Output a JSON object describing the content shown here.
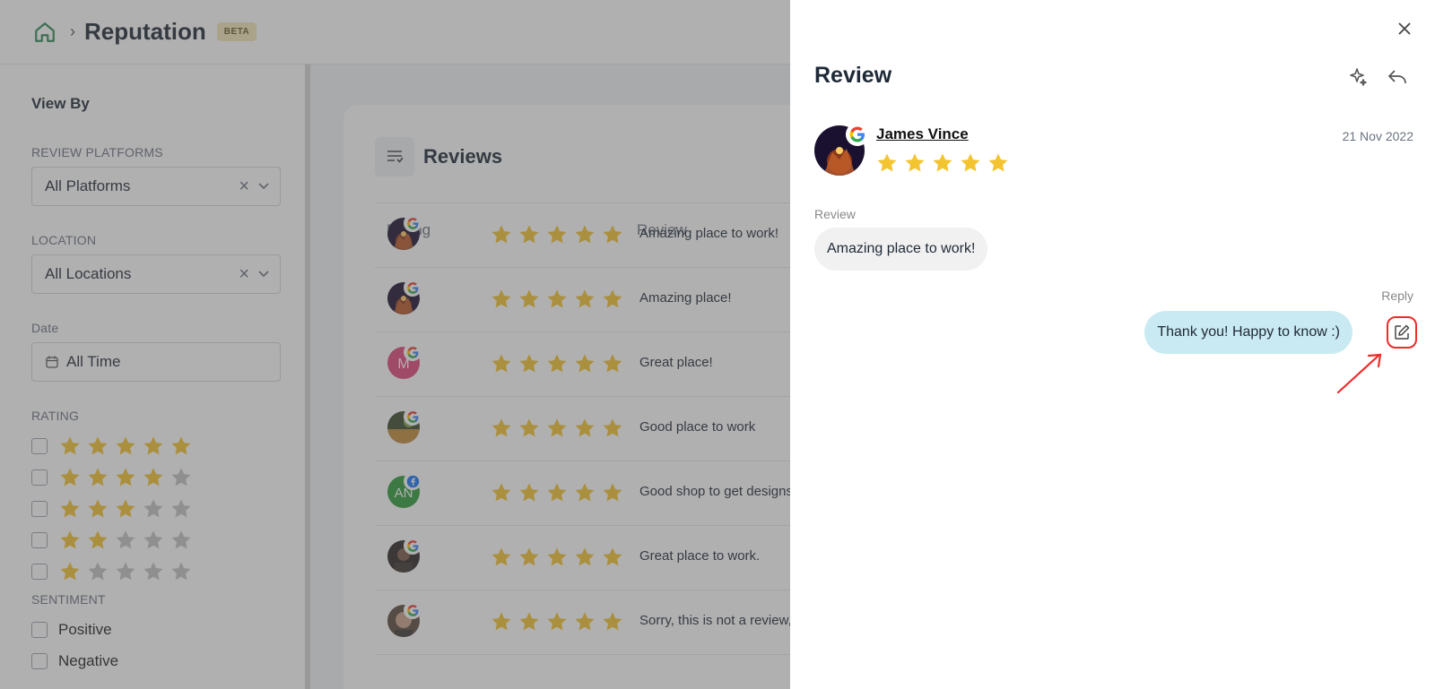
{
  "header": {
    "title": "Reputation",
    "badge": "BETA"
  },
  "filters": {
    "view_by": "View By",
    "platforms_label": "REVIEW PLATFORMS",
    "platforms_value": "All Platforms",
    "location_label": "LOCATION",
    "location_value": "All Locations",
    "date_label": "Date",
    "date_value": "All Time",
    "rating_label": "RATING",
    "rating_options": [
      5,
      4,
      3,
      2,
      1
    ],
    "sentiment_label": "SENTIMENT",
    "sentiment_options": [
      "Positive",
      "Negative"
    ]
  },
  "reviews": {
    "title": "Reviews",
    "col_rating": "Rating",
    "col_review": "Review",
    "rows": [
      {
        "avatar": "night",
        "platform": "google",
        "stars": 5,
        "text": "Amazing place to work!"
      },
      {
        "avatar": "night",
        "platform": "google",
        "stars": 5,
        "text": "Amazing place!"
      },
      {
        "avatar": "M",
        "platform": "google",
        "stars": 5,
        "text": "Great place!"
      },
      {
        "avatar": "photo",
        "platform": "google",
        "stars": 5,
        "text": "Good place to work"
      },
      {
        "avatar": "AN",
        "platform": "facebook",
        "stars": 5,
        "text": "Good shop to get designs"
      },
      {
        "avatar": "portrait",
        "platform": "google",
        "stars": 5,
        "text": "Great place to work."
      },
      {
        "avatar": "face",
        "platform": "google",
        "stars": 5,
        "text": "Sorry, this is not a review,"
      }
    ]
  },
  "drawer": {
    "title": "Review",
    "reviewer": "James Vince",
    "date": "21 Nov 2022",
    "stars": 5,
    "review_label": "Review",
    "review_text": "Amazing place to work!",
    "reply_label": "Reply",
    "reply_text": "Thank you! Happy to know :)"
  },
  "colors": {
    "star": "#f4c430",
    "star_dim": "#c4c4c4",
    "accent_red": "#ef2b2b",
    "reply_bubble": "#c9eaf2"
  }
}
